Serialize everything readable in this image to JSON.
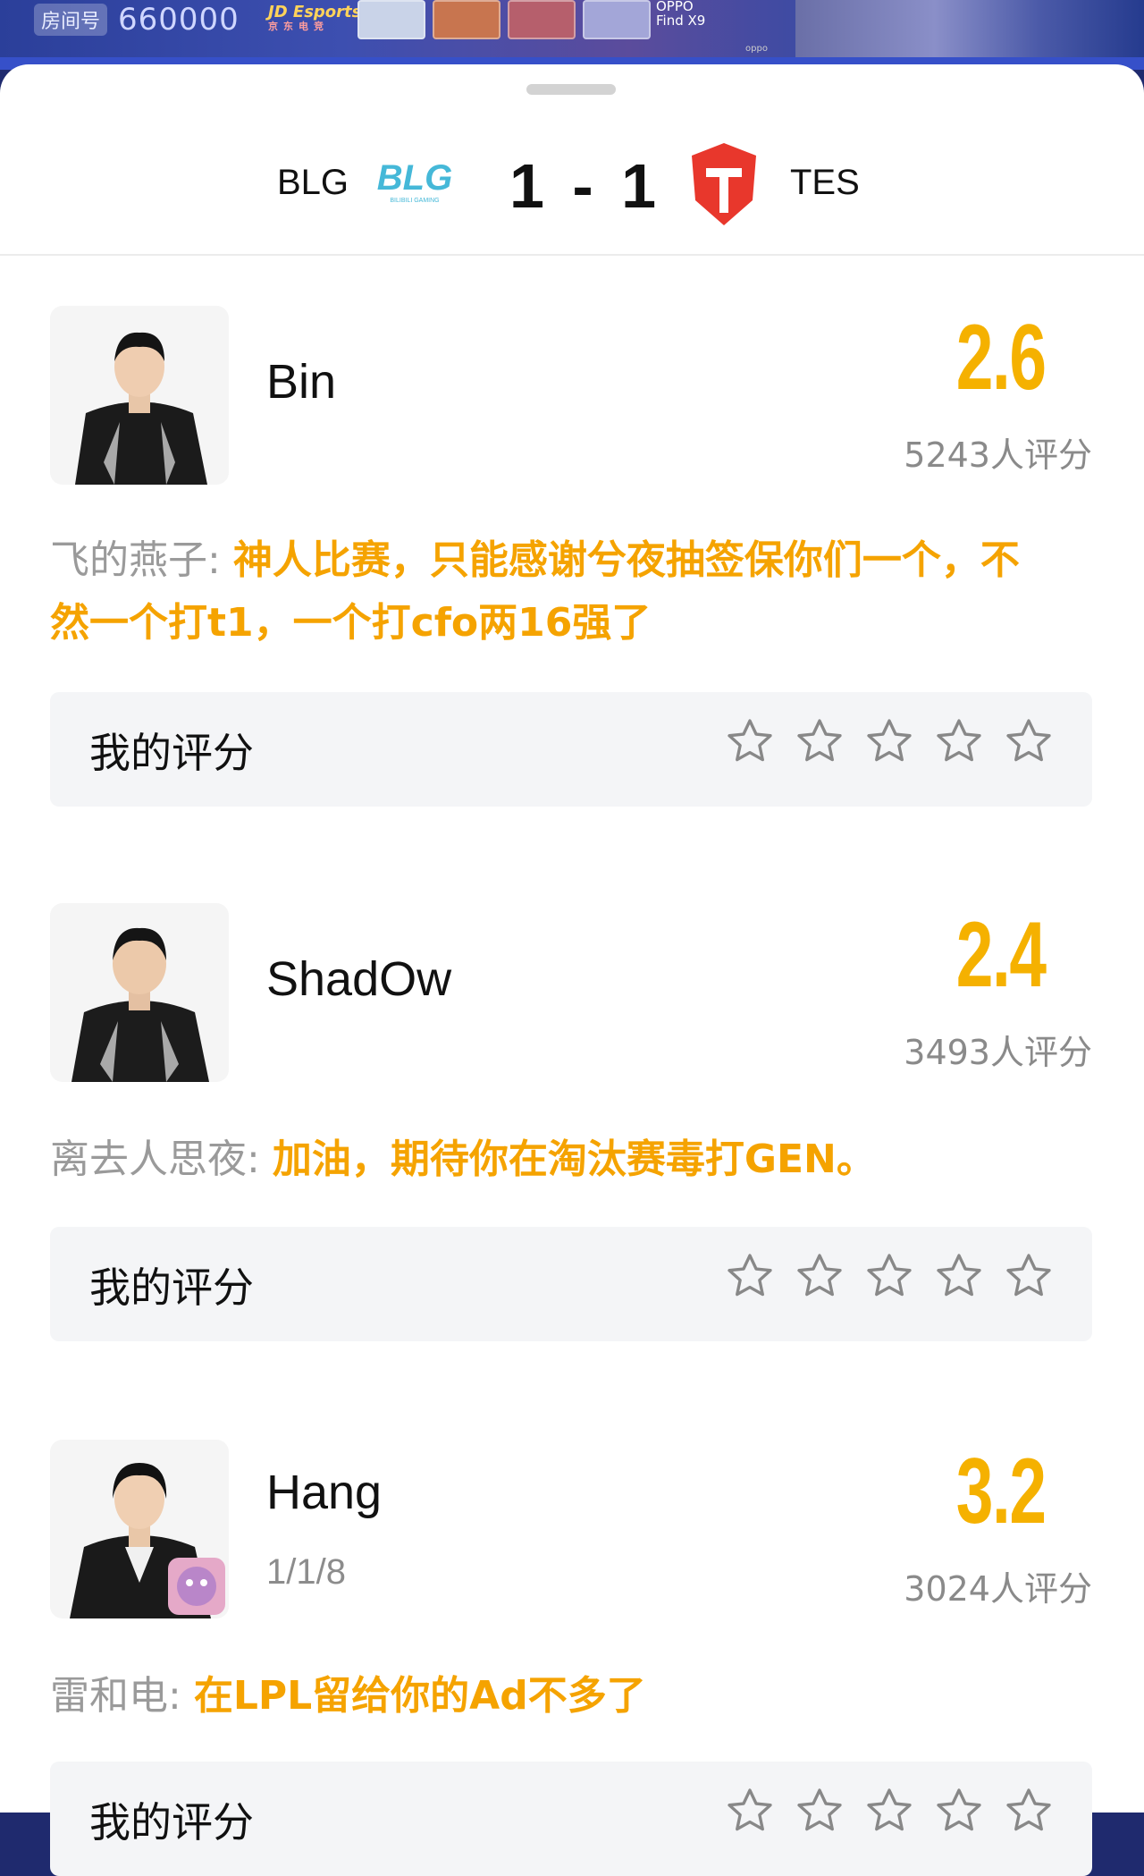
{
  "video": {
    "room_label": "房间号",
    "room_number": "660000",
    "sponsor_main": "JD Esports",
    "sponsor_sub": "京东电竞",
    "phone_ad_line1": "OPPO",
    "phone_ad_line2": "Find X9",
    "phone_ad_brand": "oppo"
  },
  "match": {
    "team1": "BLG",
    "team2": "TES",
    "score": "1 - 1",
    "team1_logo_text": "BLG",
    "team1_logo_sub": "BILIBILI GAMING",
    "team1_color": "#45b8d8",
    "team2_color": "#e8372c"
  },
  "players": [
    {
      "name": "Bin",
      "kda": "",
      "rating": "2.6",
      "rating_count": "5243人评分",
      "comment_user": "飞的燕子:",
      "comment_text": "神人比赛，只能感谢兮夜抽签保你们一个，不然一个打t1，一个打cfo两16强了",
      "my_rating_label": "我的评分"
    },
    {
      "name": "ShadOw",
      "kda": "",
      "rating": "2.4",
      "rating_count": "3493人评分",
      "comment_user": "离去人思夜:",
      "comment_text": "加油，期待你在淘汰赛毒打GEN。",
      "my_rating_label": "我的评分"
    },
    {
      "name": "Hang",
      "kda": "1/1/8",
      "rating": "3.2",
      "rating_count": "3024人评分",
      "comment_user": "雷和电:",
      "comment_text": "在LPL留给你的Ad不多了",
      "my_rating_label": "我的评分"
    }
  ],
  "colors": {
    "accent": "#f5a300",
    "rating": "#f5b100",
    "muted": "#9a9a9a"
  },
  "icons": {
    "star": "star-outline-icon"
  }
}
